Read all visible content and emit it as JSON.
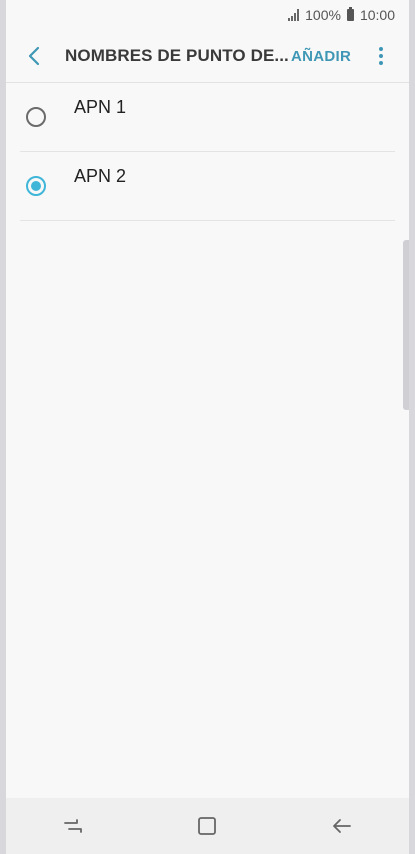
{
  "status_bar": {
    "battery_text": "100%",
    "time": "10:00",
    "icons": [
      "signal-icon",
      "battery-icon"
    ]
  },
  "header": {
    "title": "NOMBRES DE PUNTO DE...",
    "add_label": "AÑADIR",
    "icons": [
      "back-arrow-icon",
      "more-vert-icon"
    ]
  },
  "apn_list": [
    {
      "label": "APN 1",
      "selected": false
    },
    {
      "label": "APN 2",
      "selected": true
    }
  ],
  "nav_bar": {
    "icons": [
      "recent-apps-icon",
      "home-icon",
      "back-icon"
    ]
  },
  "colors": {
    "accent": "#3f97b5",
    "radio_selected": "#3fb6d8"
  }
}
